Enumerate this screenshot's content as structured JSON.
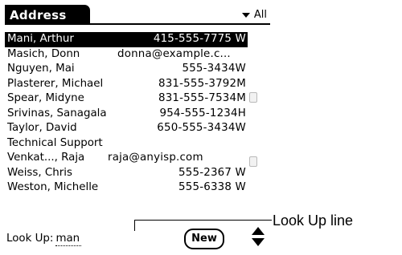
{
  "app": {
    "title": "Address",
    "category": "All"
  },
  "contacts": [
    {
      "name": "Mani, Arthur",
      "phone": "415-555-7775 W"
    },
    {
      "name": "Masich, Donn",
      "phone": "donna@example.c..."
    },
    {
      "name": "Nguyen, Mai",
      "phone": "555-3434W"
    },
    {
      "name": "Plasterer, Michael",
      "phone": "831-555-3792M"
    },
    {
      "name": "Spear, Midyne",
      "phone": "831-555-7534M"
    },
    {
      "name": "Srivinas, Sanagala",
      "phone": "954-555-1234H"
    },
    {
      "name": "Taylor, David",
      "phone": "650-555-3434W"
    },
    {
      "name": "Technical Support",
      "phone": ""
    },
    {
      "name": "Venkat..., Raja",
      "phone": "raja@anyisp.com"
    },
    {
      "name": "Weiss, Chris",
      "phone": "555-2367 W"
    },
    {
      "name": "Weston, Michelle",
      "phone": "555-6338 W"
    }
  ],
  "lookup": {
    "label": "Look Up:",
    "value": "man"
  },
  "buttons": {
    "new_label": "New"
  },
  "callout": {
    "label": "Look Up line"
  },
  "icons": {
    "category": "dropdown-triangle-icon",
    "scroll": "scroll-arrows-icon"
  }
}
